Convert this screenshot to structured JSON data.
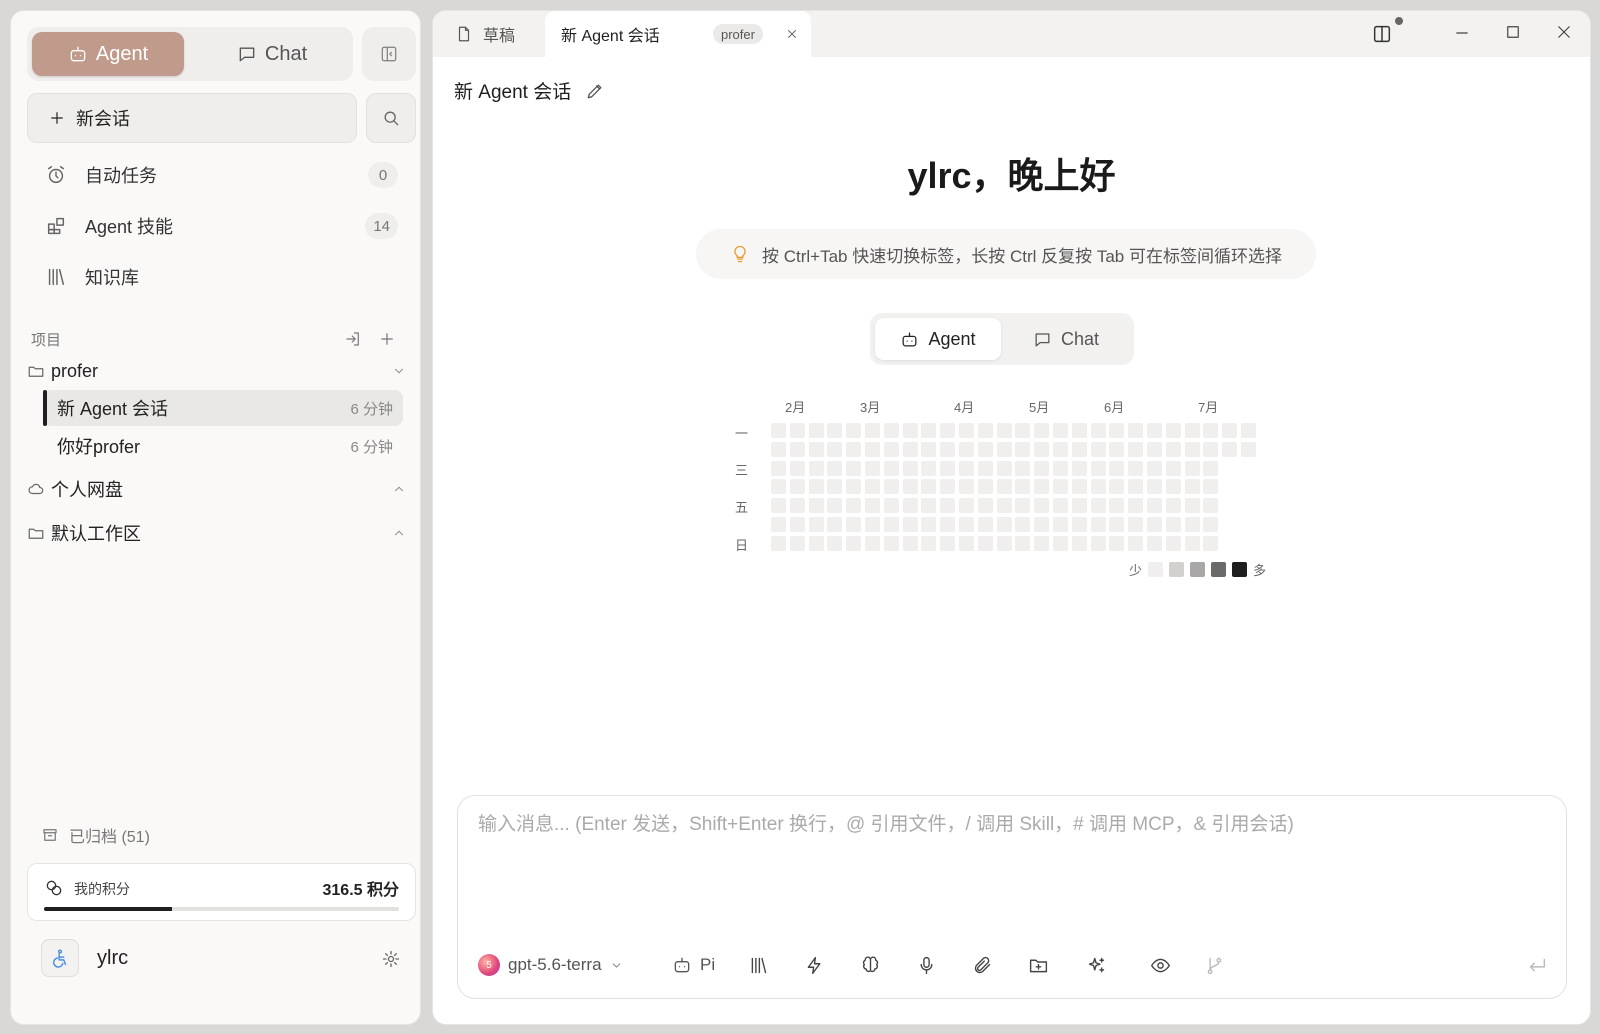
{
  "sidebar": {
    "mode_agent": "Agent",
    "mode_chat": "Chat",
    "new_chat": "新会话",
    "nav": [
      {
        "label": "自动任务",
        "count": "0",
        "icon": "alarm-icon"
      },
      {
        "label": "Agent 技能",
        "count": "14",
        "icon": "skills-grid-icon"
      },
      {
        "label": "知识库",
        "count": "",
        "icon": "library-icon"
      }
    ],
    "projects_label": "项目",
    "folders": {
      "profer": "profer",
      "drive": "个人网盘",
      "workspace": "默认工作区"
    },
    "sessions": [
      {
        "title": "新 Agent 会话",
        "time": "6 分钟",
        "active": true
      },
      {
        "title": "你好profer",
        "time": "6 分钟",
        "active": false
      }
    ],
    "archived": "已归档 (51)",
    "points": {
      "label": "我的积分",
      "value": "316.5 积分",
      "progress": 0.36
    },
    "user": {
      "name": "ylrc"
    }
  },
  "tabs": {
    "draft": "草稿",
    "active": "新 Agent 会话",
    "badge": "profer"
  },
  "main": {
    "session_title": "新 Agent 会话",
    "greeting": "ylrc，晚上好",
    "tip": "按 Ctrl+Tab 快速切换标签，长按 Ctrl 反复按 Tab 可在标签间循环选择",
    "mode_agent": "Agent",
    "mode_chat": "Chat",
    "heatmap": {
      "months": [
        "2月",
        "3月",
        "4月",
        "5月",
        "6月",
        "7月"
      ],
      "days": [
        "一",
        "三",
        "五",
        "日"
      ],
      "legend_less": "少",
      "legend_more": "多",
      "legend_colors": [
        "#f0efed",
        "#d2d1cf",
        "#a9a8a6",
        "#6b6a69",
        "#1e1e1e"
      ]
    },
    "composer": {
      "placeholder": "输入消息... (Enter 发送，Shift+Enter 换行，@ 引用文件，/ 调用 Skill，# 调用 MCP，& 引用会话)",
      "model": "gpt-5.6-terra",
      "model_badge": "5",
      "agent": "Pi"
    }
  },
  "colors": {
    "accent": "#c09a8a",
    "tip_icon": "#e89a2e"
  }
}
